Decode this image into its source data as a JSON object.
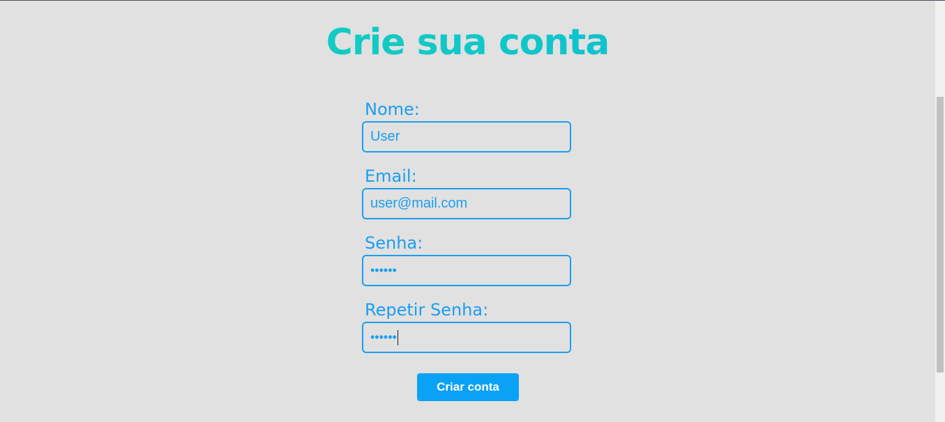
{
  "page": {
    "title": "Crie sua conta"
  },
  "form": {
    "fields": [
      {
        "label": "Nome:",
        "value": "User",
        "type": "text"
      },
      {
        "label": "Email:",
        "value": "user@mail.com",
        "type": "text"
      },
      {
        "label": "Senha:",
        "value": "••••••",
        "type": "password"
      },
      {
        "label": "Repetir Senha:",
        "value": "••••••",
        "type": "password"
      }
    ],
    "submit_label": "Criar conta"
  },
  "colors": {
    "background": "#e1e1e1",
    "accent": "#1a9ef0",
    "button": "#0aa2f5",
    "title_gradient_start": "#17d3b2",
    "title_gradient_end": "#0bb6dc"
  }
}
